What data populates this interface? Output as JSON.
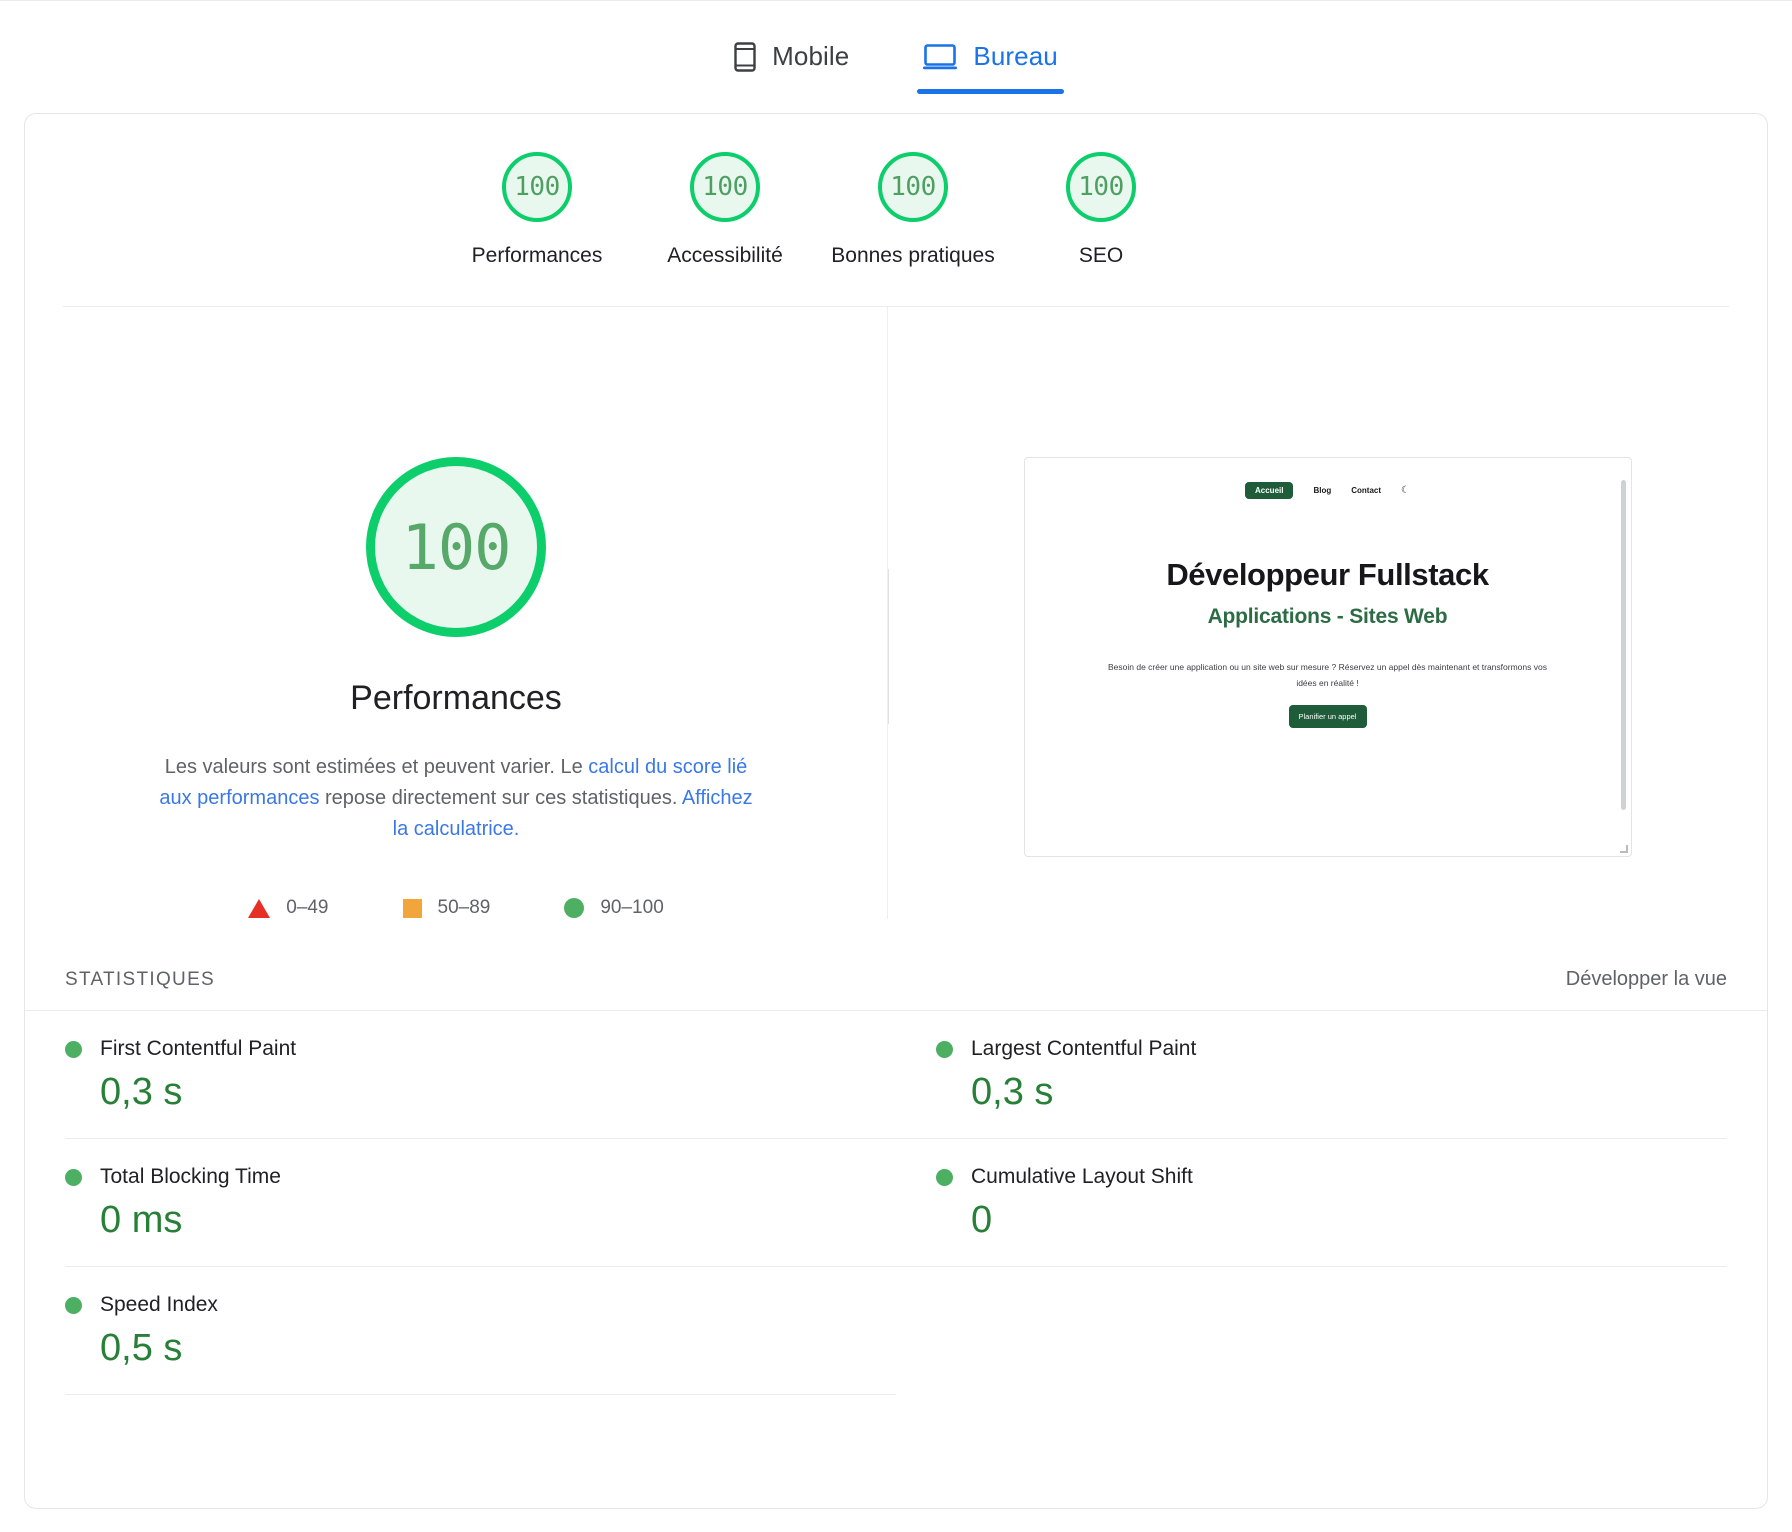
{
  "tabs": [
    {
      "label": "Mobile",
      "icon": "mobile-icon",
      "active": false
    },
    {
      "label": "Bureau",
      "icon": "desktop-icon",
      "active": true
    }
  ],
  "category_scores": [
    {
      "label": "Performances",
      "score": "100"
    },
    {
      "label": "Accessibilité",
      "score": "100"
    },
    {
      "label": "Bonnes pratiques",
      "score": "100"
    },
    {
      "label": "SEO",
      "score": "100"
    }
  ],
  "detail": {
    "score": "100",
    "title": "Performances",
    "description_part1": "Les valeurs sont estimées et peuvent varier. Le ",
    "link1": "calcul du score lié aux performances",
    "description_part2": " repose directement sur ces statistiques. ",
    "link2": "Affichez la calculatrice.",
    "legend": [
      {
        "shape": "triangle",
        "range": "0–49",
        "color": "#e63026"
      },
      {
        "shape": "square",
        "range": "50–89",
        "color": "#f1a53a"
      },
      {
        "shape": "circle",
        "range": "90–100",
        "color": "#4caf62"
      }
    ]
  },
  "thumbnail": {
    "nav_home": "Accueil",
    "nav_blog": "Blog",
    "nav_contact": "Contact",
    "nav_theme_icon": "moon-icon",
    "heading": "Développeur Fullstack",
    "subheading": "Applications - Sites Web",
    "paragraph": "Besoin de créer une application ou un site web sur mesure ? Réservez un appel dès maintenant et transformons vos idées en réalité !",
    "cta": "Planifier un appel"
  },
  "statistics": {
    "title": "STATISTIQUES",
    "expand_label": "Développer la vue",
    "metrics": [
      {
        "name": "First Contentful Paint",
        "value": "0,3 s",
        "status": "good"
      },
      {
        "name": "Largest Contentful Paint",
        "value": "0,3 s",
        "status": "good"
      },
      {
        "name": "Total Blocking Time",
        "value": "0 ms",
        "status": "good"
      },
      {
        "name": "Cumulative Layout Shift",
        "value": "0",
        "status": "good"
      },
      {
        "name": "Speed Index",
        "value": "0,5 s",
        "status": "good"
      }
    ]
  },
  "colors": {
    "green": "#0cce6b",
    "green_text": "#288038",
    "green_dot": "#4caf62",
    "link_blue": "#3b78e7",
    "accent_blue": "#1a73e8"
  }
}
